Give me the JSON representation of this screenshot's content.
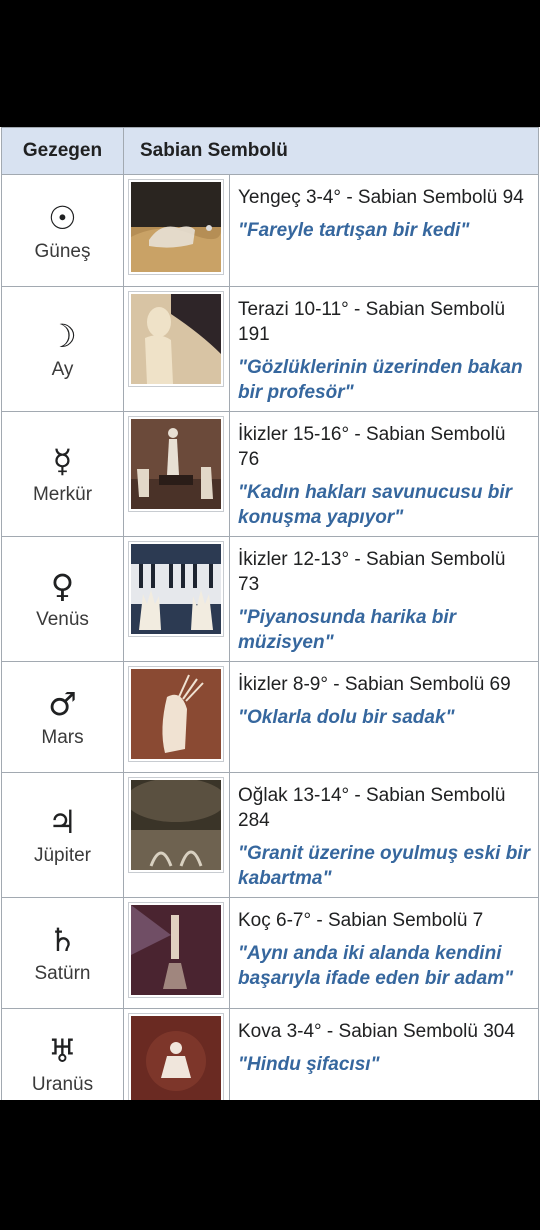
{
  "table": {
    "headers": [
      "Gezegen",
      "Sabian Sembolü"
    ],
    "rows": [
      {
        "planet": "Güneş",
        "glyph": "☉",
        "icon": "sun-symbol-icon",
        "degree": "Yengeç 3-4° - Sabian Sembolü 94",
        "symbol": "\"Fareyle tartışan bir kedi\""
      },
      {
        "planet": "Ay",
        "glyph": "☽",
        "icon": "moon-symbol-icon",
        "degree": "Terazi 10-11° - Sabian Sembolü 191",
        "symbol": "\"Gözlüklerinin üzerinden bakan bir profesör\""
      },
      {
        "planet": "Merkür",
        "glyph": "☿",
        "icon": "mercury-symbol-icon",
        "degree": "İkizler 15-16° - Sabian Sembolü 76",
        "symbol": "\"Kadın hakları savunucusu bir konuşma yapıyor\""
      },
      {
        "planet": "Venüs",
        "glyph": "♀",
        "icon": "venus-symbol-icon",
        "degree": "İkizler 12-13° - Sabian Sembolü 73",
        "symbol": "\"Piyanosunda harika bir müzisyen\""
      },
      {
        "planet": "Mars",
        "glyph": "♂",
        "icon": "mars-symbol-icon",
        "degree": "İkizler 8-9° - Sabian Sembolü 69",
        "symbol": "\"Oklarla dolu bir sadak\""
      },
      {
        "planet": "Jüpiter",
        "glyph": "♃",
        "icon": "jupiter-symbol-icon",
        "degree": "Oğlak 13-14° - Sabian Sembolü 284",
        "symbol": "\"Granit üzerine oyulmuş eski bir kabartma\""
      },
      {
        "planet": "Satürn",
        "glyph": "♄",
        "icon": "saturn-symbol-icon",
        "degree": "Koç 6-7° - Sabian Sembolü 7",
        "symbol": "\"Aynı anda iki alanda kendini başarıyla ifade eden bir adam\""
      },
      {
        "planet": "Uranüs",
        "glyph": "♅",
        "icon": "uranus-symbol-icon",
        "degree": "Kova 3-4° - Sabian Sembolü 304",
        "symbol": "\"Hindu şifacısı\""
      }
    ]
  }
}
